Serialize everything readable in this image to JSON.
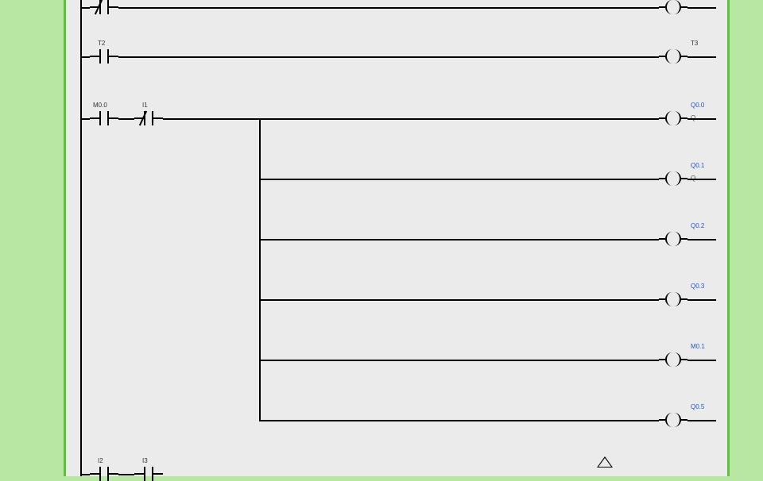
{
  "diagram": {
    "type": "plc-ladder",
    "description": "PLC ladder logic segment with multiple rungs and parallel output coils"
  },
  "rungs": {
    "r1": {
      "contacts": [
        {
          "type": "NC",
          "label": ""
        }
      ],
      "outputs": [
        {
          "label": "",
          "sub": ""
        }
      ]
    },
    "r2": {
      "contacts": [
        {
          "type": "NO",
          "label": "T2"
        }
      ],
      "outputs": [
        {
          "label": "T3",
          "sub": ""
        }
      ]
    },
    "r3": {
      "contacts": [
        {
          "type": "NO",
          "label": "M0.0"
        },
        {
          "type": "NC",
          "label": "I1"
        }
      ],
      "outputs": [
        {
          "label": "Q0.0",
          "sub": "Q"
        },
        {
          "label": "Q0.1",
          "sub": "Q"
        },
        {
          "label": "Q0.2",
          "sub": ""
        },
        {
          "label": "Q0.3",
          "sub": ""
        },
        {
          "label": "M0.1",
          "sub": ""
        },
        {
          "label": "Q0.5",
          "sub": ""
        }
      ]
    },
    "r4": {
      "contacts": [
        {
          "type": "NO",
          "label": "I2"
        },
        {
          "type": "NO",
          "label": "I3"
        }
      ]
    }
  }
}
